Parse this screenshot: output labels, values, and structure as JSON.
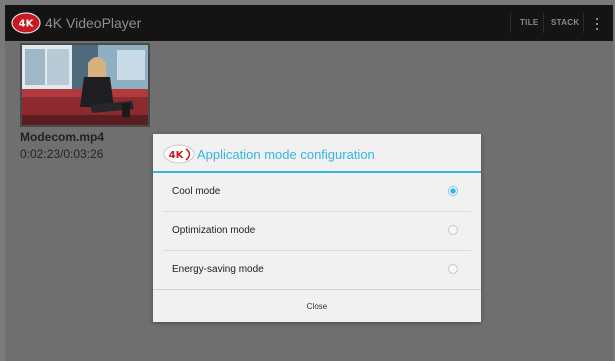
{
  "actionbar": {
    "logo_icon": "4k-logo-icon",
    "title": "4K VideoPlayer",
    "tile_label": "TILE",
    "stack_label": "STACK",
    "overflow_icon": "overflow-menu-icon"
  },
  "video": {
    "file_name": "Modecom.mp4",
    "time": "0:02:23/0:03:26"
  },
  "dialog": {
    "title": "Application mode configuration",
    "options": [
      {
        "label": "Cool mode",
        "selected": true
      },
      {
        "label": "Optimization mode",
        "selected": false
      },
      {
        "label": "Energy-saving mode",
        "selected": false
      }
    ],
    "close_label": "Close"
  },
  "colors": {
    "accent": "#35b5e5",
    "actionbar_bg": "#141414",
    "background": "#6f6f6f",
    "dialog_bg": "#f1f1f1"
  }
}
